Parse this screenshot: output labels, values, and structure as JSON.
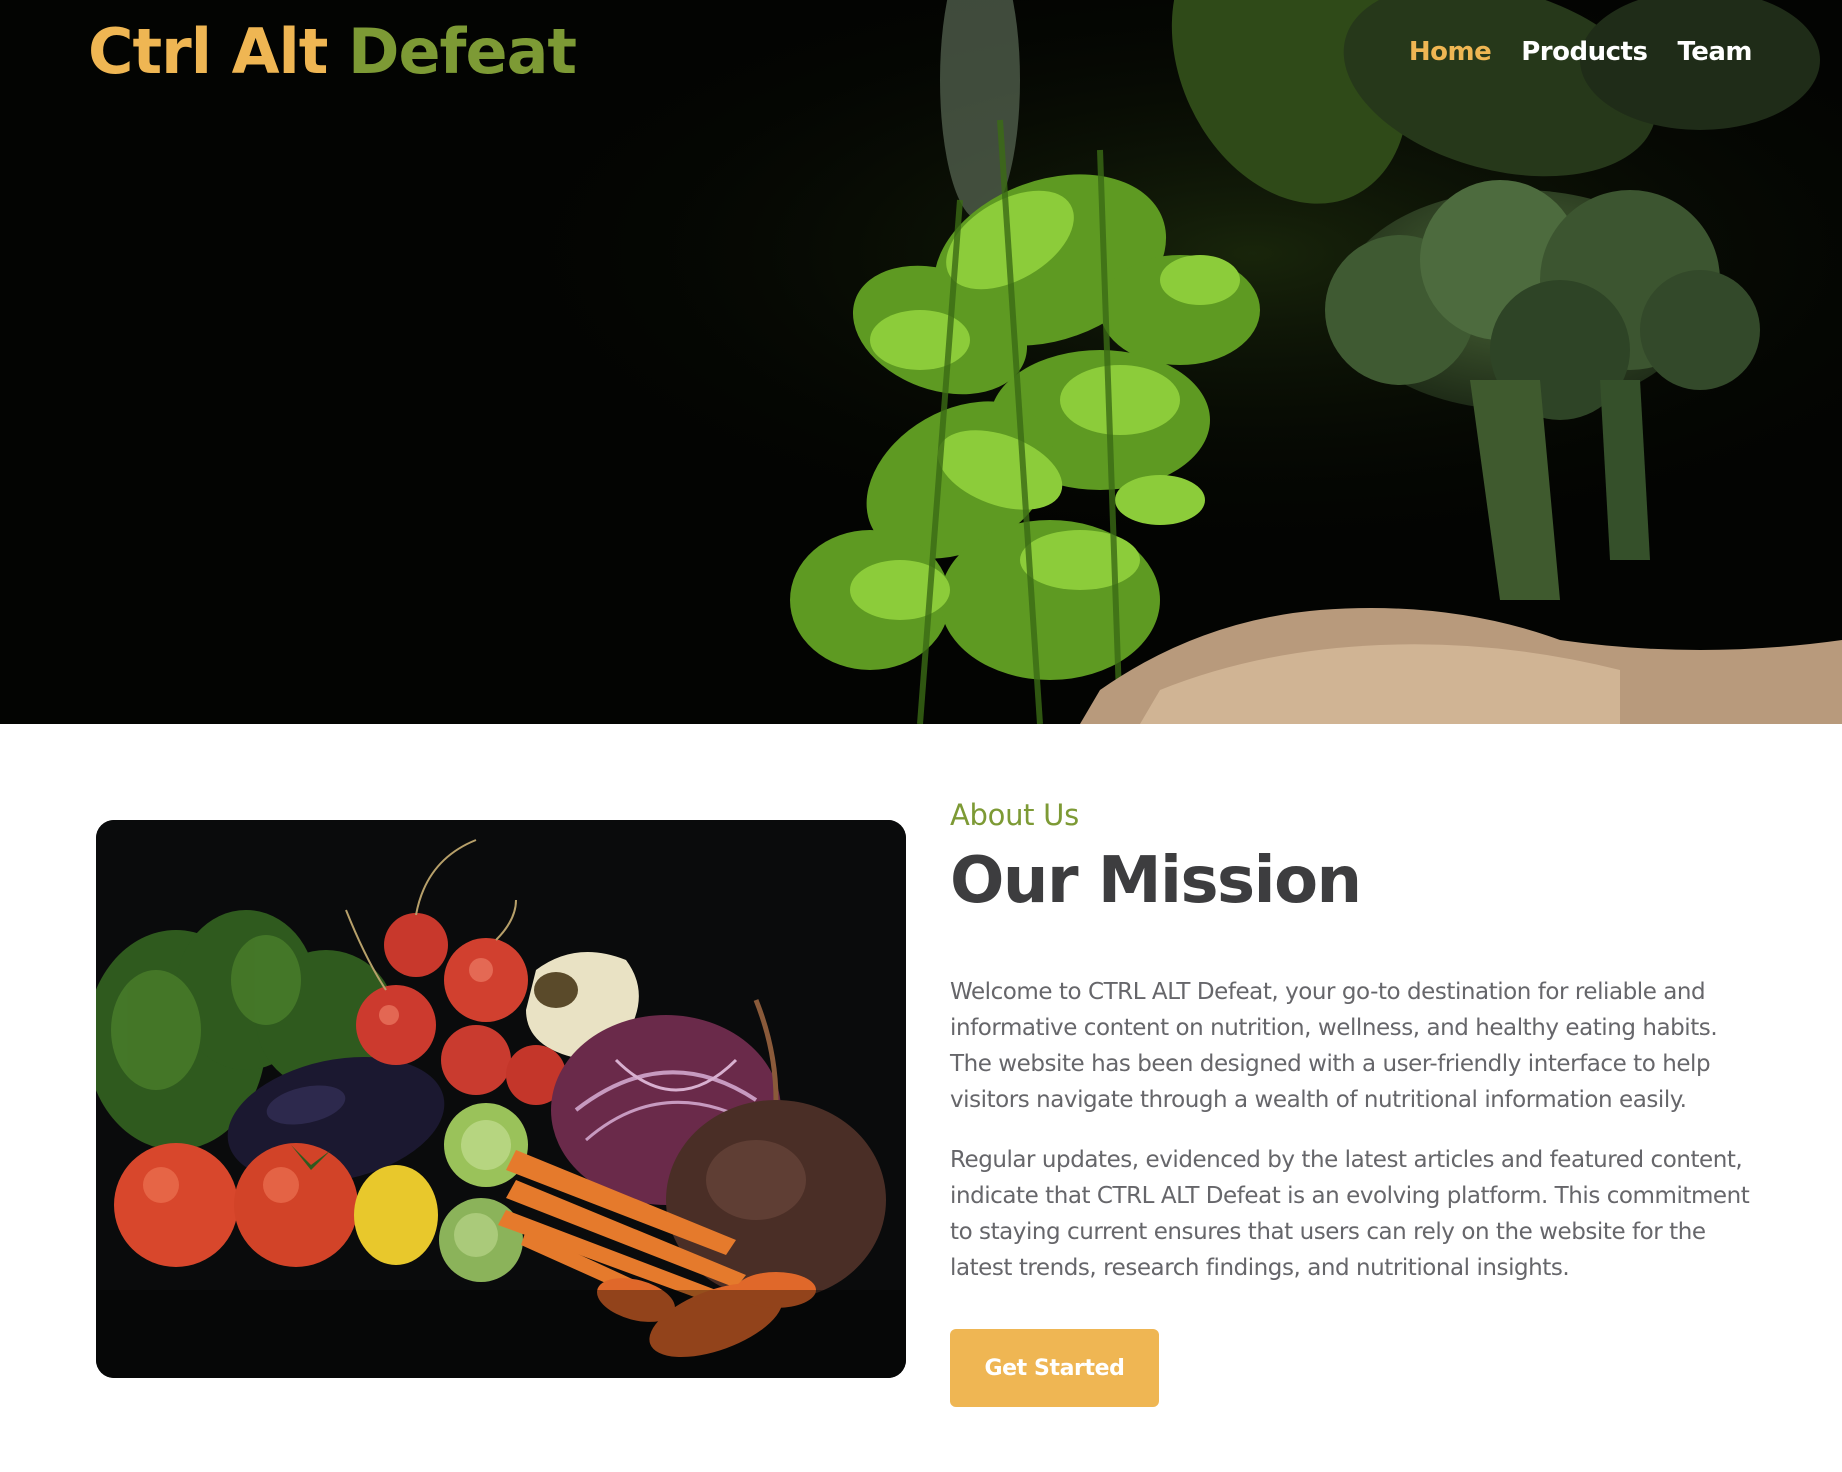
{
  "header": {
    "brand": {
      "word1": "Ctrl",
      "word2": "Alt",
      "word3": "Defeat"
    },
    "nav": [
      {
        "label": "Home",
        "active": true
      },
      {
        "label": "Products",
        "active": false
      },
      {
        "label": "Team",
        "active": false
      }
    ]
  },
  "hero": {
    "image": "dark-leafy-greens-and-broccoli-photo"
  },
  "about": {
    "image": "vegetables-still-life-photo",
    "eyebrow": "About Us",
    "heading": "Our Mission",
    "paragraphs": [
      "Welcome to CTRL ALT Defeat, your go-to destination for reliable and informative content on nutrition, wellness, and healthy eating habits. The website has been designed with a user-friendly interface to help visitors navigate through a wealth of nutritional information easily.",
      "Regular updates, evidenced by the latest articles and featured content, indicate that CTRL ALT Defeat is an evolving platform. This commitment to staying current ensures that users can rely on the website for the latest trends, research findings, and nutritional insights."
    ],
    "cta_label": "Get Started"
  },
  "colors": {
    "accent_gold": "#efb653",
    "accent_green": "#7d9a35",
    "heading_text": "#3d3d3f",
    "body_text": "#66666a",
    "hero_background": "#030402"
  }
}
